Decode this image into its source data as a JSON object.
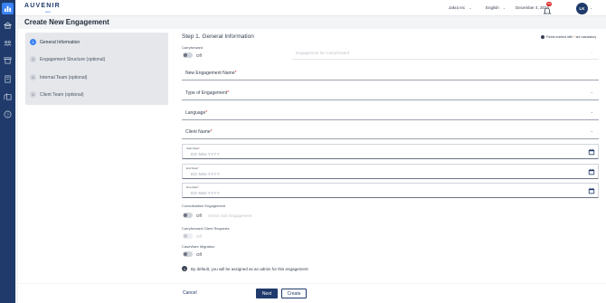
{
  "app": {
    "logo": "AUVENIR",
    "logo_sub": "beta"
  },
  "topbar": {
    "company": "Jakra Inc",
    "language": "English",
    "date": "December 4, 2024",
    "notification_count": "99",
    "avatar_initials": "LK"
  },
  "page": {
    "title": "Create New Engagement"
  },
  "stepper": {
    "steps": [
      {
        "num": "1",
        "label": "General Information"
      },
      {
        "num": "2",
        "label": "Engagement Structure (optional)"
      },
      {
        "num": "3",
        "label": "Internal Team (optional)"
      },
      {
        "num": "4",
        "label": "Client Team (optional)"
      }
    ]
  },
  "form": {
    "heading": "Step 1. General Information",
    "mandatory_note_pre": "Fields marked with",
    "mandatory_note_star": "*",
    "mandatory_note_post": "are mandatory",
    "required_star": "*",
    "carryforward": {
      "label": "Carryforward",
      "state": "Off",
      "select_placeholder": "Engagement for Carryforward"
    },
    "engagement_name": {
      "label": "New Engagement Name"
    },
    "engagement_type": {
      "label": "Type of Engagement"
    },
    "language": {
      "label": "Language"
    },
    "client_name": {
      "label": "Client Name"
    },
    "start_date": {
      "label": "Start Date",
      "placeholder": "DD-MM-YYYY"
    },
    "end_date": {
      "label": "End Date",
      "placeholder": "DD-MM-YYYY"
    },
    "due_date": {
      "label": "Due Date",
      "placeholder": "DD-MM-YYYY"
    },
    "consolidation": {
      "label": "Consolidation Engagement",
      "state": "Off",
      "select_placeholder": "Select Sub Engagement"
    },
    "carryforward_requests": {
      "label": "Carryforward Client Requests",
      "state": "Off"
    },
    "caseware": {
      "label": "CaseWare Migration",
      "state": "Off"
    },
    "info_text": "By default, you will be assigned as an admin for this engagement"
  },
  "footer": {
    "cancel": "Cancel",
    "next": "Next",
    "create": "Create"
  },
  "colors": {
    "primary": "#1f3a6b",
    "accent": "#3b82f6",
    "required": "#dc2626"
  },
  "icons": [
    "dashboard-icon",
    "bank-icon",
    "people-icon",
    "archive-icon",
    "book-icon",
    "building-icon",
    "help-icon",
    "bell-icon",
    "calendar-icon",
    "info-icon"
  ]
}
